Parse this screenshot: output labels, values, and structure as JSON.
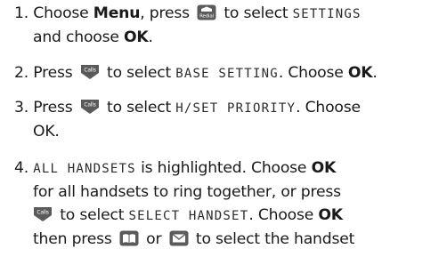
{
  "steps": [
    {
      "num": "1.",
      "line1": {
        "a": "Choose ",
        "b_menu": "Menu",
        "c": ", press ",
        "d": " to select ",
        "lcd": "SETTINGS"
      },
      "line2": {
        "a": "and choose ",
        "b_ok": "OK",
        "c": "."
      },
      "redial_key": "Redial"
    },
    {
      "num": "2.",
      "line1": {
        "a": "Press ",
        "d": " to select ",
        "lcd": "BASE SETTING",
        "e": ". Choose ",
        "b_ok": "OK",
        "f": "."
      },
      "calls_key": "Calls"
    },
    {
      "num": "3.",
      "line1": {
        "a": "Press ",
        "d": " to select ",
        "lcd": "H/SET PRIORITY",
        "e": ". Choose"
      },
      "line2": {
        "a": "OK."
      },
      "calls_key": "Calls"
    },
    {
      "num": "4.",
      "line1": {
        "lcd": "ALL HANDSETS",
        "a": " is highlighted. Choose ",
        "b_ok": "OK"
      },
      "line2": {
        "a": "for all handsets to ring together, or press"
      },
      "line3": {
        "d": " to select ",
        "lcd": "SELECT HANDSET",
        "e": ". Choose ",
        "b_ok": "OK"
      },
      "line4": {
        "a": "then press ",
        "or": " or ",
        "d": " to select the handset"
      },
      "calls_key": "Calls"
    }
  ],
  "icons": {
    "redial": "redial-key-icon",
    "calls": "calls-key-icon",
    "phonebook": "phonebook-key-icon",
    "messages": "envelope-key-icon"
  },
  "colors": {
    "key_fill": "#5a5a5a",
    "text": "#1a1a1a"
  }
}
